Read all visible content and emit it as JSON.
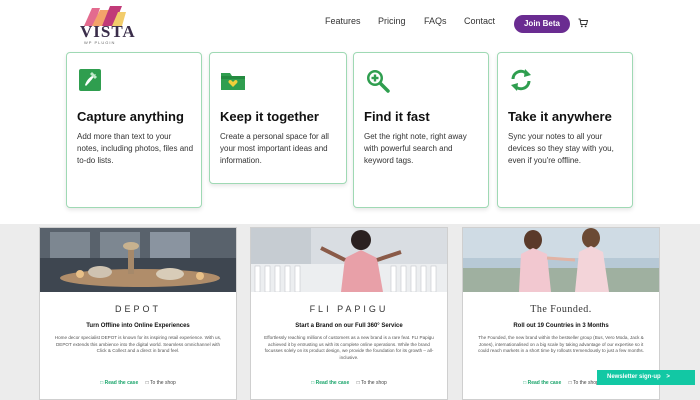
{
  "header": {
    "logo_text": "VISTA",
    "logo_subtext": "WP PLUGIN",
    "nav": [
      "Features",
      "Pricing",
      "FAQs",
      "Contact"
    ],
    "join_label": "Join Beta",
    "cart_icon": "cart-icon",
    "accent_color": "#6a2c91"
  },
  "features": [
    {
      "icon": "evernote-note-icon",
      "title": "Capture anything",
      "desc": "Add more than text to your notes, including photos, files and to-do lists."
    },
    {
      "icon": "folder-heart-icon",
      "title": "Keep it together",
      "desc": "Create a personal space for all your most important ideas and information."
    },
    {
      "icon": "search-plus-icon",
      "title": "Find it fast",
      "desc": "Get the right note, right away with powerful search and keyword tags."
    },
    {
      "icon": "sync-icon",
      "title": "Take it anywhere",
      "desc": "Sync your notes to all your devices so they stay with you, even if you're offline."
    }
  ],
  "cases": [
    {
      "brand": "DEPOT",
      "title": "Turn Offline into Online Experiences",
      "desc": "Home decor specialist DEPOT is known for its inspiring retail experience. With us, DEPOT extends this ambience into the digital world. Seamless omnichannel with Click & Collect and a direct in brand feel.",
      "read": "Read the case",
      "shop": "To the shop"
    },
    {
      "brand": "FLI PAPIGU",
      "title": "Start a Brand on our Full 360° Service",
      "desc": "Effortlessly reaching millions of customers as a new brand is a rare feat. FLI Papigu achieved it by entrusting us with its complete online operations. While the brand focusses solely on its product design, we provide the foundation for its growth – all-inclusive.",
      "read": "Read the case",
      "shop": "To the shop"
    },
    {
      "brand": "The Founded.",
      "title": "Roll out 19 Countries in 3 Months",
      "desc": "The Founded, the new brand within the bestseller group (Bus, Vero Moda, Jack & Jones), internationalised on a big scale by taking advantage of our expertise so it could reach markets in a short time by rollouts tremendously to just a few months.",
      "read": "Read the case",
      "shop": "To the shop"
    }
  ],
  "newsletter": {
    "label": "Newsletter sign-up",
    "arrow": ">"
  },
  "colors": {
    "card_border": "#9fd9b4",
    "green": "#1aa56b",
    "newsletter": "#12c8a4"
  }
}
